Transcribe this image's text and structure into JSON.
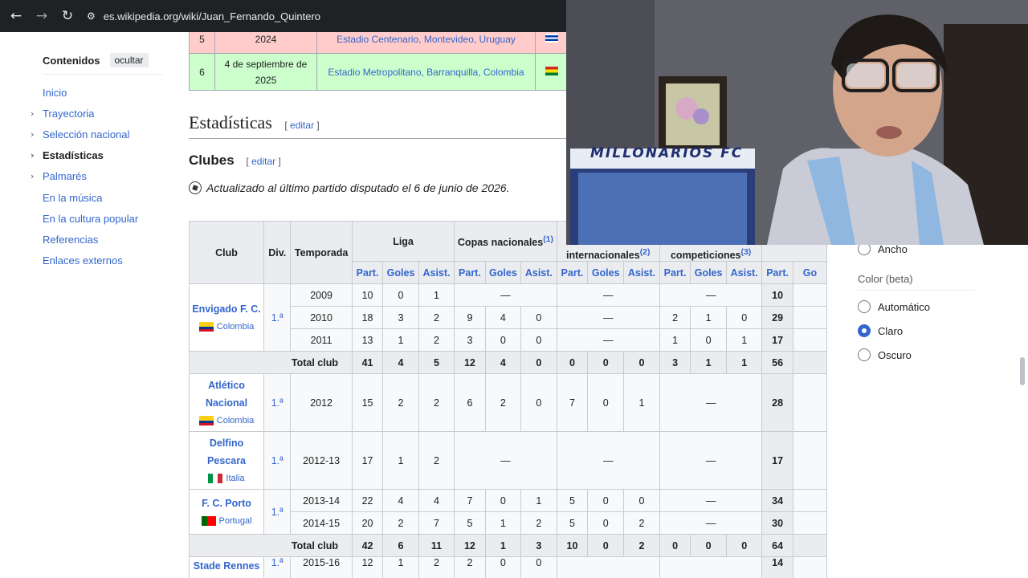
{
  "browser": {
    "url": "es.wikipedia.org/wiki/Juan_Fernando_Quintero"
  },
  "toc": {
    "title": "Contenidos",
    "hide_label": "ocultar",
    "items": [
      {
        "label": "Inicio"
      },
      {
        "label": "Trayectoria"
      },
      {
        "label": "Selección nacional"
      },
      {
        "label": "Estadísticas"
      },
      {
        "label": "Palmarés"
      },
      {
        "label": "En la música"
      },
      {
        "label": "En la cultura popular"
      },
      {
        "label": "Referencias"
      },
      {
        "label": "Enlaces externos"
      }
    ]
  },
  "matches": [
    {
      "num": "5",
      "date": "2024",
      "venue": "Estadio Centenario, Montevideo, Uruguay"
    },
    {
      "num": "6",
      "date": "4 de septiembre de 2025",
      "venue": "Estadio Metropolitano, Barranquilla, Colombia"
    }
  ],
  "section": {
    "title": "Estadísticas",
    "edit": "editar"
  },
  "subsection": {
    "title": "Clubes",
    "edit": "editar"
  },
  "note": "Actualizado al último partido disputado el 6 de junio de 2026.",
  "stats": {
    "headers": {
      "club": "Club",
      "div": "Div.",
      "season": "Temporada",
      "liga": "Liga",
      "copas": "Copas nacionales",
      "copas_ref": "(1)",
      "inter": "internacionales",
      "inter_ref": "(2)",
      "otras": "competiciones",
      "otras_ref": "(3)",
      "part": "Part.",
      "goles": "Goles",
      "asist": "Asist.",
      "total_goles_partial": "Go"
    },
    "dash": "—",
    "total_label": "Total club",
    "clubs": [
      {
        "name": "Envigado F. C.",
        "country": "Colombia",
        "div": "1.ª",
        "seasons": [
          [
            "2009",
            "10",
            "0",
            "1",
            "",
            "",
            "",
            "",
            "",
            "",
            "",
            "",
            "",
            "10"
          ],
          [
            "2010",
            "18",
            "3",
            "2",
            "9",
            "4",
            "0",
            "",
            "",
            "",
            "2",
            "1",
            "0",
            "29"
          ],
          [
            "2011",
            "13",
            "1",
            "2",
            "3",
            "0",
            "0",
            "",
            "",
            "",
            "1",
            "0",
            "1",
            "17"
          ]
        ],
        "total": [
          "41",
          "4",
          "5",
          "12",
          "4",
          "0",
          "0",
          "0",
          "0",
          "3",
          "1",
          "1",
          "56"
        ]
      },
      {
        "name": "Atlético Nacional",
        "country": "Colombia",
        "div": "1.ª",
        "seasons": [
          [
            "2012",
            "15",
            "2",
            "2",
            "6",
            "2",
            "0",
            "7",
            "0",
            "1",
            "",
            "",
            "",
            "28"
          ]
        ]
      },
      {
        "name": "Delfino Pescara",
        "country": "Italia",
        "div": "1.ª",
        "seasons": [
          [
            "2012-13",
            "17",
            "1",
            "2",
            "",
            "",
            "",
            "",
            "",
            "",
            "",
            "",
            "",
            "17"
          ]
        ]
      },
      {
        "name": "F. C. Porto",
        "country": "Portugal",
        "div": "1.ª",
        "seasons": [
          [
            "2013-14",
            "22",
            "4",
            "4",
            "7",
            "0",
            "1",
            "5",
            "0",
            "0",
            "",
            "",
            "",
            "34"
          ],
          [
            "2014-15",
            "20",
            "2",
            "7",
            "5",
            "1",
            "2",
            "5",
            "0",
            "2",
            "",
            "",
            "",
            "30"
          ]
        ],
        "total": [
          "42",
          "6",
          "11",
          "12",
          "1",
          "3",
          "10",
          "0",
          "2",
          "0",
          "0",
          "0",
          "64"
        ]
      },
      {
        "name": "Stade Rennes",
        "div": "1.ª",
        "seasons": [
          [
            "2015-16",
            "12",
            "1",
            "2",
            "2",
            "0",
            "0",
            "",
            "",
            "",
            "",
            "",
            "",
            "14"
          ]
        ]
      }
    ]
  },
  "appearance": {
    "width_option": "Ancho",
    "color_title": "Color (beta)",
    "options": [
      "Automático",
      "Claro",
      "Oscuro"
    ],
    "selected": "Claro"
  },
  "webcam": {
    "banner_text": "MILLONARIOS FC"
  }
}
